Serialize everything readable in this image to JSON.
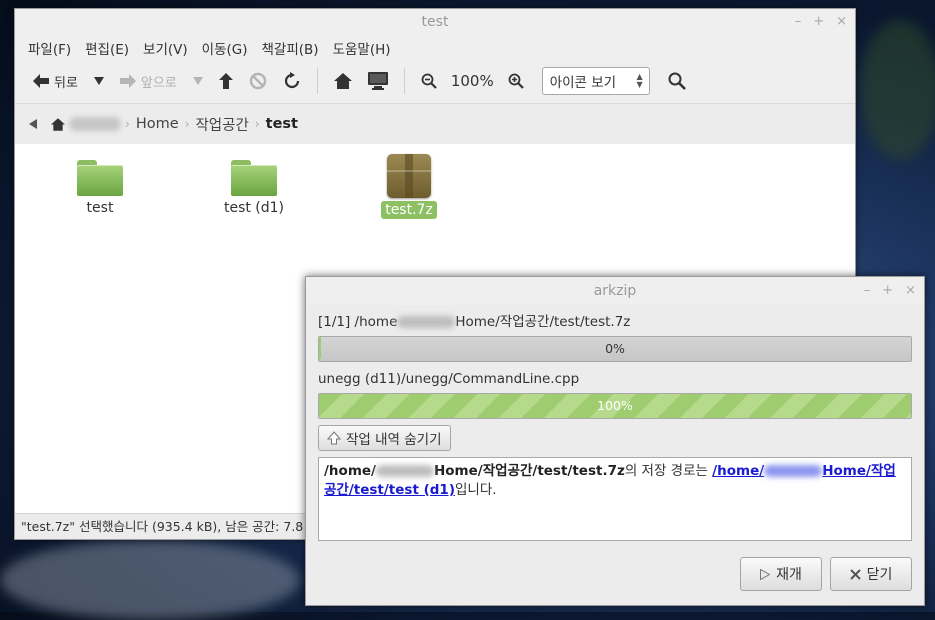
{
  "file_manager": {
    "title": "test",
    "window_controls": {
      "minimize": "–",
      "maximize": "+",
      "close": "×"
    },
    "menu": [
      "파일(F)",
      "편집(E)",
      "보기(V)",
      "이동(G)",
      "책갈피(B)",
      "도움말(H)"
    ],
    "toolbar": {
      "back_label": "뒤로",
      "forward_label": "앞으로",
      "zoom_level": "100%",
      "view_mode": "아이콘 보기"
    },
    "breadcrumb": [
      "Home",
      "작업공간",
      "test"
    ],
    "files": [
      {
        "name": "test",
        "type": "folder"
      },
      {
        "name": "test (d1)",
        "type": "folder"
      },
      {
        "name": "test.7z",
        "type": "archive",
        "selected": true
      }
    ],
    "status": "\"test.7z\" 선택했습니다 (935.4 kB), 남은 공간: 7.8"
  },
  "arkzip": {
    "title": "arkzip",
    "window_controls": {
      "minimize": "–",
      "maximize": "+",
      "close": "×"
    },
    "archive_line": {
      "prefix": "[1/1] /home",
      "suffix": "Home/작업공간/test/test.7z"
    },
    "overall_progress": {
      "value": 0,
      "label": "0%"
    },
    "current_file": "unegg (d11)/unegg/CommandLine.cpp",
    "file_progress": {
      "value": 100,
      "label": "100%"
    },
    "toggle_label": "작업 내역 숨기기",
    "log": {
      "src_prefix": "/home/",
      "src_suffix": "Home/작업공간/test/test.7z",
      "middle": "의 저장 경로는 ",
      "dest_prefix": "/home/",
      "dest_suffix": "Home/작업공간/test/test (d1)",
      "end": "입니다."
    },
    "buttons": {
      "replay": "재개",
      "close": "닫기"
    }
  }
}
